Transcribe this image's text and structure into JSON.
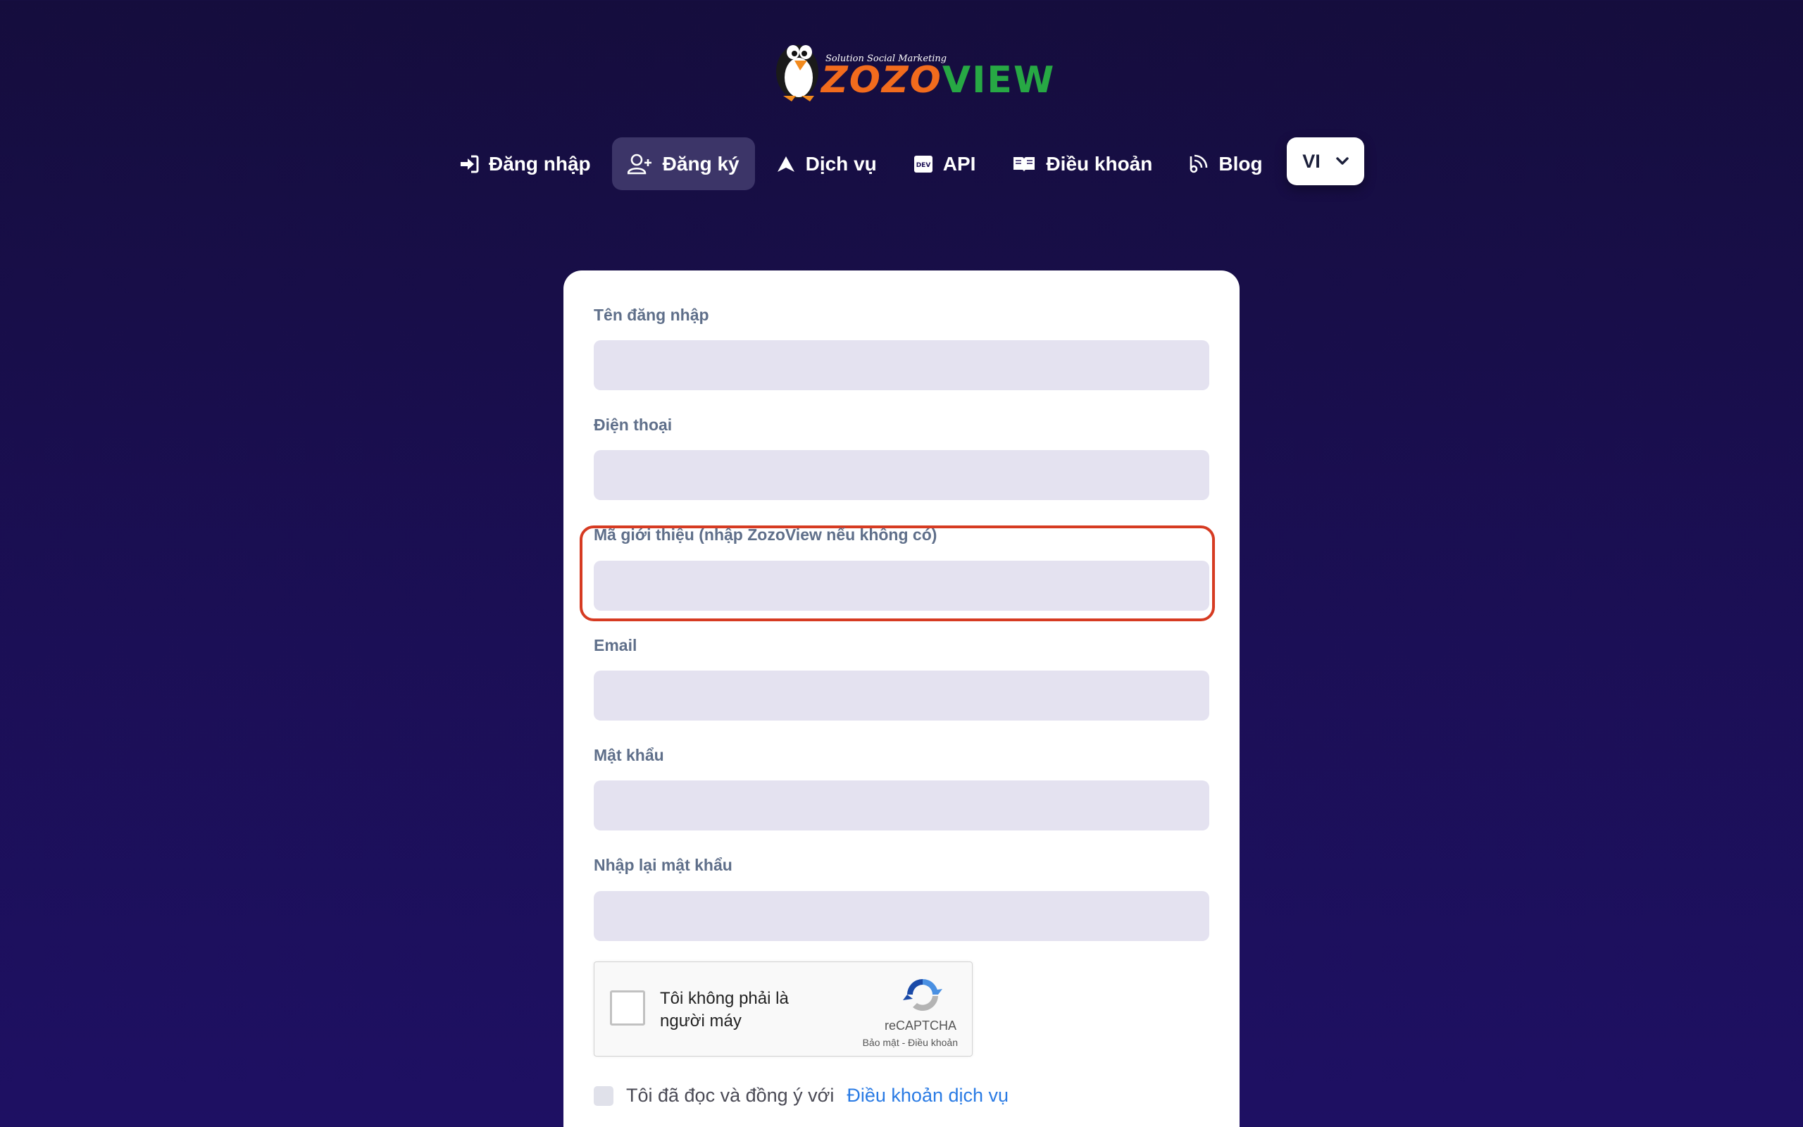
{
  "logo": {
    "tagline": "Solution Social Marketing",
    "word_part1": "ZOZO",
    "word_part2": "VIEW"
  },
  "nav": {
    "items": [
      {
        "label": "Đăng nhập",
        "icon": "sign-in-icon"
      },
      {
        "label": "Đăng ký",
        "icon": "user-plus-icon",
        "active": true
      },
      {
        "label": "Dịch vụ",
        "icon": "paper-plane-icon"
      },
      {
        "label": "API",
        "icon": "dev-badge-icon"
      },
      {
        "label": "Điều khoản",
        "icon": "open-book-icon"
      },
      {
        "label": "Blog",
        "icon": "blog-icon"
      }
    ],
    "language": "VI"
  },
  "form": {
    "fields": [
      {
        "label": "Tên đăng nhập",
        "value": ""
      },
      {
        "label": "Điện thoại",
        "value": ""
      },
      {
        "label": "Mã giới thiệu (nhập ZozoView nếu không có)",
        "value": ""
      },
      {
        "label": "Email",
        "value": ""
      },
      {
        "label": "Mật khẩu",
        "value": ""
      },
      {
        "label": "Nhập lại mật khẩu",
        "value": ""
      }
    ],
    "recaptcha": {
      "text": "Tôi không phải là người máy",
      "brand": "reCAPTCHA",
      "links": "Bảo mật - Điều khoản"
    },
    "terms": {
      "text": "Tôi đã đọc và đồng ý với",
      "link": "Điều khoản dịch vụ"
    }
  },
  "colors": {
    "background": "#1b0f55",
    "active_nav": "#3c3568",
    "input_bg": "#e4e2f0",
    "highlight": "#d63b22",
    "link": "#2a7be4"
  }
}
